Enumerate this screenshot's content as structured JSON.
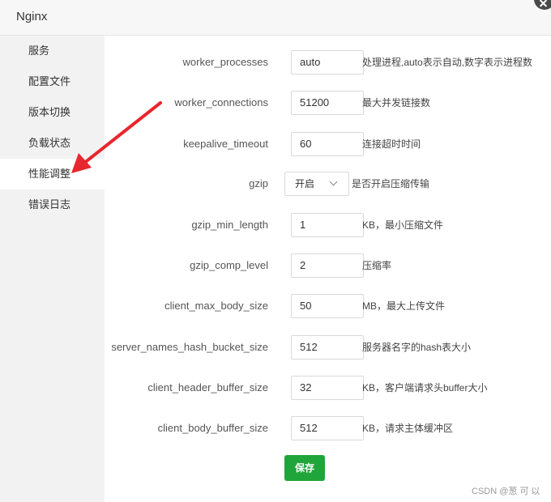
{
  "window": {
    "title": "Nginx"
  },
  "sidebar": {
    "items": [
      {
        "label": "服务"
      },
      {
        "label": "配置文件"
      },
      {
        "label": "版本切换"
      },
      {
        "label": "负载状态"
      },
      {
        "label": "性能调整",
        "active": true
      },
      {
        "label": "错误日志"
      }
    ]
  },
  "form": {
    "rows": [
      {
        "label": "worker_processes",
        "value": "auto",
        "desc": "处理进程,auto表示自动,数字表示进程数"
      },
      {
        "label": "worker_connections",
        "value": "51200",
        "desc": "最大并发链接数"
      },
      {
        "label": "keepalive_timeout",
        "value": "60",
        "desc": "连接超时时间"
      },
      {
        "label": "gzip",
        "value": "开启",
        "desc": "是否开启压缩传输"
      },
      {
        "label": "gzip_min_length",
        "value": "1",
        "desc": "KB，最小压缩文件"
      },
      {
        "label": "gzip_comp_level",
        "value": "2",
        "desc": "压缩率"
      },
      {
        "label": "client_max_body_size",
        "value": "50",
        "desc": "MB，最大上传文件"
      },
      {
        "label": "server_names_hash_bucket_size",
        "value": "512",
        "desc": "服务器名字的hash表大小"
      },
      {
        "label": "client_header_buffer_size",
        "value": "32",
        "desc": "KB，客户端请求头buffer大小"
      },
      {
        "label": "client_body_buffer_size",
        "value": "512",
        "desc": "KB，请求主体缓冲区"
      }
    ],
    "save_label": "保存"
  },
  "watermark": "CSDN @葱 可 以",
  "colors": {
    "accent": "#20a53a",
    "arrow": "#e8262d",
    "sidebar_bg": "#f2f2f2"
  },
  "icons": {
    "close": "close-icon",
    "select": "chevron-down-icon",
    "annotation": "red-arrow"
  }
}
